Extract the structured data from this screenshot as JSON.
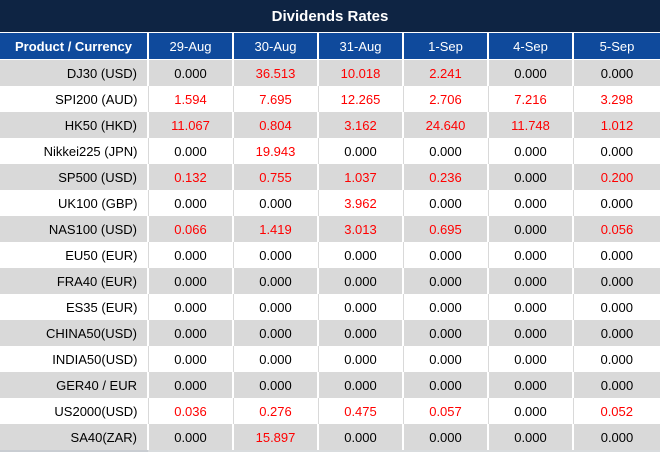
{
  "title": "Dividends Rates",
  "table": {
    "columns": [
      "Product / Currency",
      "29-Aug",
      "30-Aug",
      "31-Aug",
      "1-Sep",
      "4-Sep",
      "5-Sep"
    ],
    "rows": [
      {
        "product": "DJ30 (USD)",
        "values": [
          "0.000",
          "36.513",
          "10.018",
          "2.241",
          "0.000",
          "0.000"
        ]
      },
      {
        "product": "SPI200 (AUD)",
        "values": [
          "1.594",
          "7.695",
          "12.265",
          "2.706",
          "7.216",
          "3.298"
        ]
      },
      {
        "product": "HK50 (HKD)",
        "values": [
          "11.067",
          "0.804",
          "3.162",
          "24.640",
          "11.748",
          "1.012"
        ]
      },
      {
        "product": "Nikkei225 (JPN)",
        "values": [
          "0.000",
          "19.943",
          "0.000",
          "0.000",
          "0.000",
          "0.000"
        ]
      },
      {
        "product": "SP500 (USD)",
        "values": [
          "0.132",
          "0.755",
          "1.037",
          "0.236",
          "0.000",
          "0.200"
        ]
      },
      {
        "product": "UK100 (GBP)",
        "values": [
          "0.000",
          "0.000",
          "3.962",
          "0.000",
          "0.000",
          "0.000"
        ]
      },
      {
        "product": "NAS100 (USD)",
        "values": [
          "0.066",
          "1.419",
          "3.013",
          "0.695",
          "0.000",
          "0.056"
        ]
      },
      {
        "product": "EU50 (EUR)",
        "values": [
          "0.000",
          "0.000",
          "0.000",
          "0.000",
          "0.000",
          "0.000"
        ]
      },
      {
        "product": "FRA40 (EUR)",
        "values": [
          "0.000",
          "0.000",
          "0.000",
          "0.000",
          "0.000",
          "0.000"
        ]
      },
      {
        "product": "ES35 (EUR)",
        "values": [
          "0.000",
          "0.000",
          "0.000",
          "0.000",
          "0.000",
          "0.000"
        ]
      },
      {
        "product": "CHINA50(USD)",
        "values": [
          "0.000",
          "0.000",
          "0.000",
          "0.000",
          "0.000",
          "0.000"
        ]
      },
      {
        "product": "INDIA50(USD)",
        "values": [
          "0.000",
          "0.000",
          "0.000",
          "0.000",
          "0.000",
          "0.000"
        ]
      },
      {
        "product": "GER40 / EUR",
        "values": [
          "0.000",
          "0.000",
          "0.000",
          "0.000",
          "0.000",
          "0.000"
        ]
      },
      {
        "product": "US2000(USD)",
        "values": [
          "0.036",
          "0.276",
          "0.475",
          "0.057",
          "0.000",
          "0.052"
        ]
      },
      {
        "product": "SA40(ZAR)",
        "values": [
          "0.000",
          "15.897",
          "0.000",
          "0.000",
          "0.000",
          "0.000"
        ]
      }
    ]
  },
  "colors": {
    "title_bar": "#0e2443",
    "header_blue": "#0f4a9c",
    "row_gray": "#d9d9d9",
    "row_white": "#ffffff",
    "value_red": "#ff0000",
    "value_black": "#000000"
  }
}
